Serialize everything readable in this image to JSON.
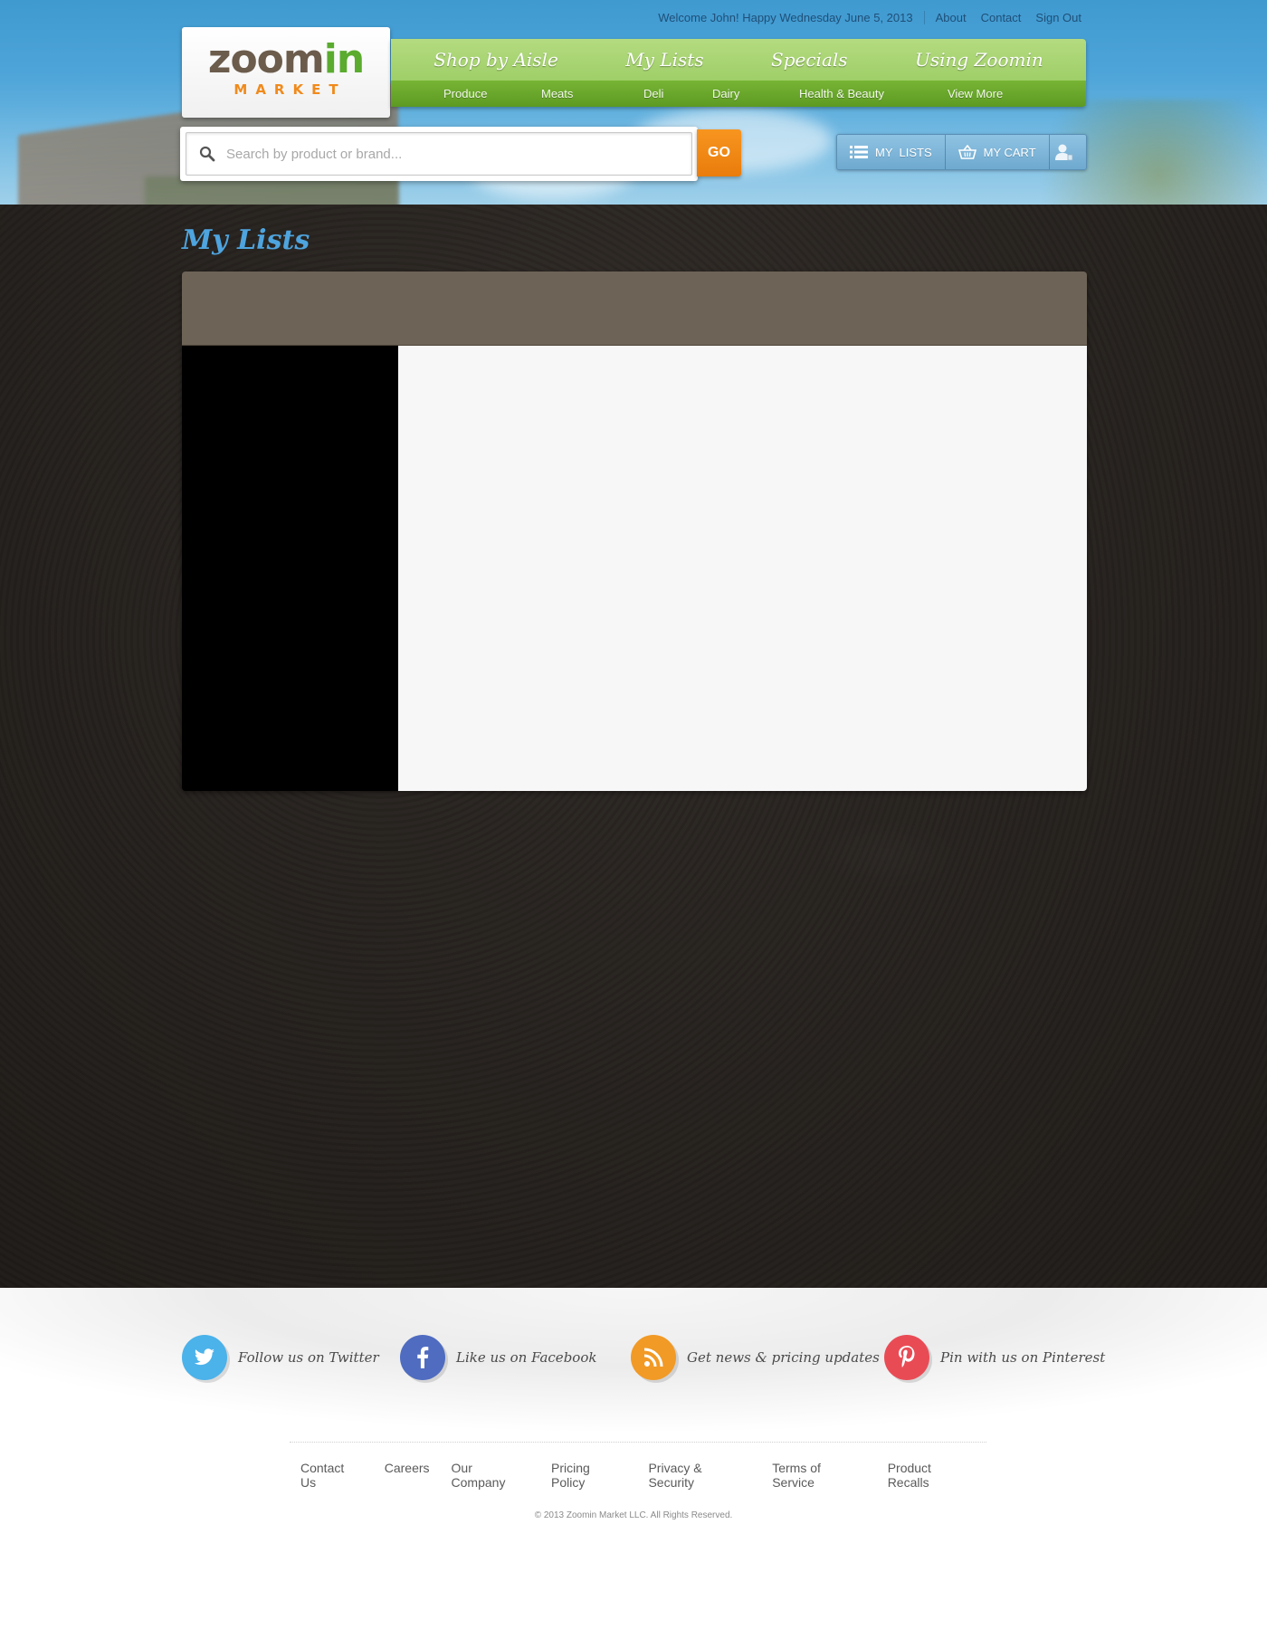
{
  "topbar": {
    "welcome": "Welcome John! Happy Wednesday June 5, 2013",
    "links": [
      "About",
      "Contact",
      "Sign Out"
    ]
  },
  "logo": {
    "zoom": "zoom",
    "in": "in",
    "market": "MARKET"
  },
  "nav": {
    "primary": [
      "Shop by Aisle",
      "My Lists",
      "Specials",
      "Using Zoomin"
    ],
    "secondary": [
      "Produce",
      "Meats",
      "Deli",
      "Dairy",
      "Health & Beauty",
      "View More"
    ]
  },
  "search": {
    "placeholder": "Search by product or brand...",
    "value": "",
    "go_label": "GO"
  },
  "toolbar": {
    "lists_label": "MY  LISTS",
    "cart_label": "MY CART"
  },
  "main": {
    "title": "My Lists"
  },
  "social": [
    {
      "icon": "twitter-icon",
      "label": "Follow us on Twitter",
      "color": "#4bb2ea"
    },
    {
      "icon": "facebook-icon",
      "label": "Like us on Facebook",
      "color": "#4f6cc0"
    },
    {
      "icon": "rss-icon",
      "label": "Get news & pricing updates",
      "color": "#f19a26"
    },
    {
      "icon": "pinterest-icon",
      "label": "Pin with us on Pinterest",
      "color": "#e94b55"
    }
  ],
  "footer": {
    "links": [
      "Contact Us",
      "Careers",
      "Our Company",
      "Pricing Policy",
      "Privacy & Security",
      "Terms of Service",
      "Product Recalls"
    ],
    "copyright": "© 2013 Zoomin Market LLC. All Rights Reserved."
  },
  "colors": {
    "nav_green": "#9fcf68",
    "subnav_green": "#5c9a22",
    "go_orange": "#f08a1c",
    "title_blue": "#4ea4de",
    "main_bg": "#2a2521"
  }
}
